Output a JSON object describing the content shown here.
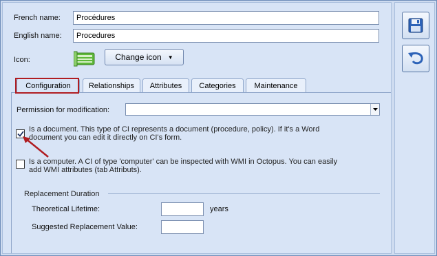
{
  "form": {
    "french_name_label": "French name:",
    "french_name_value": "Procédures",
    "english_name_label": "English name:",
    "english_name_value": "Procedures",
    "icon_label": "Icon:",
    "change_icon_label": "Change icon"
  },
  "tabs": [
    {
      "label": "Configuration",
      "active": true
    },
    {
      "label": "Relationships",
      "active": false
    },
    {
      "label": "Attributes",
      "active": false
    },
    {
      "label": "Categories",
      "active": false
    },
    {
      "label": "Maintenance",
      "active": false
    }
  ],
  "configuration": {
    "permission_label": "Permission for modification:",
    "permission_value": "",
    "document_text_line1": "Is a document. This type of CI represents a document (procedure, policy). If it's a Word",
    "document_text_line2": "document you can edit it directly on CI's form.",
    "document_checked": true,
    "computer_text_line1": "Is a computer. A CI of type 'computer' can be inspected with WMI in Octopus. You can easily",
    "computer_text_line2": "add WMI attributes (tab Attributs).",
    "computer_checked": false,
    "replacement_group_label": "Replacement Duration",
    "lifetime_label": "Theoretical Lifetime:",
    "lifetime_value": "",
    "lifetime_unit": "years",
    "replacement_value_label": "Suggested Replacement Value:",
    "replacement_value": ""
  },
  "side": {
    "save_icon": "save-icon",
    "undo_icon": "undo-icon"
  },
  "colors": {
    "highlight": "#b01d22",
    "panel": "#d8e4f6"
  }
}
